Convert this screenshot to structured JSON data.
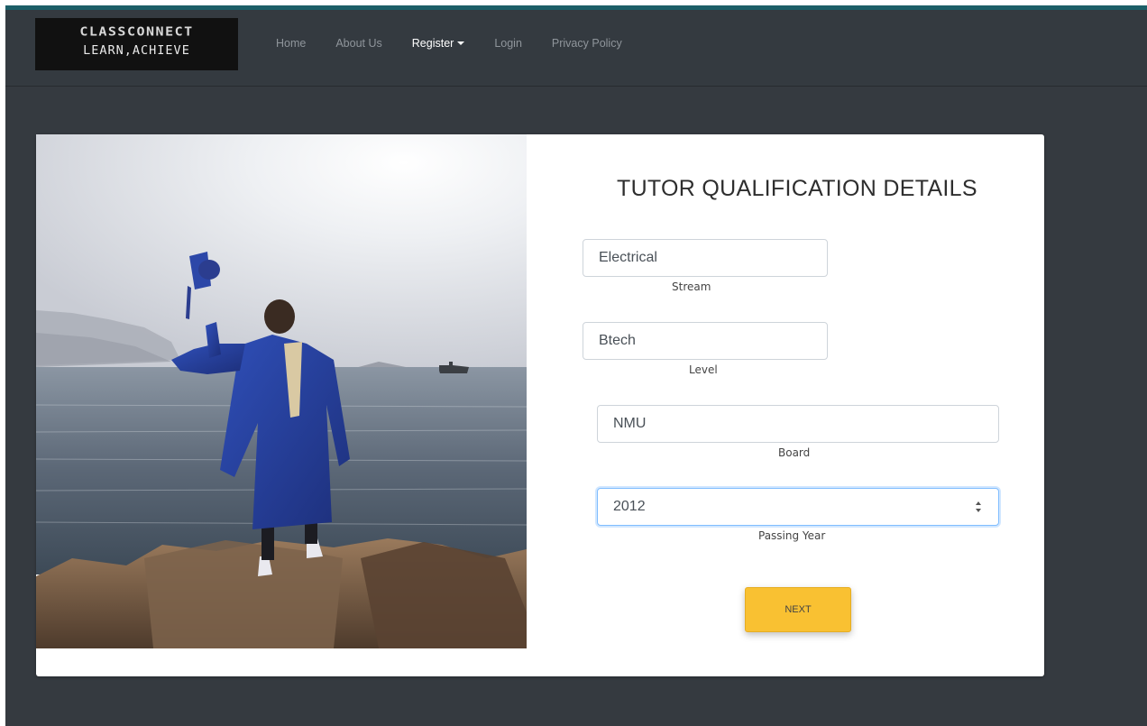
{
  "brand": {
    "line1": "CLASSCONNECT",
    "line2": "LEARN,ACHIEVE"
  },
  "nav": {
    "items": [
      {
        "label": "Home"
      },
      {
        "label": "About Us"
      },
      {
        "label": "Register"
      },
      {
        "label": "Login"
      },
      {
        "label": "Privacy Policy"
      }
    ],
    "active": "Register"
  },
  "form": {
    "title": "TUTOR QUALIFICATION DETAILS",
    "fields": [
      {
        "value": "Electrical",
        "label": "Stream"
      },
      {
        "value": "Btech",
        "label": "Level"
      },
      {
        "value": "NMU",
        "label": "Board"
      },
      {
        "value": "2012",
        "label": "Passing Year"
      }
    ],
    "next_label": "NEXT"
  },
  "colors": {
    "navbar_bg": "#343a40",
    "accent_top": "#1c5e67",
    "button_bg": "#f9c132",
    "focus_border": "#80bdff"
  },
  "icons": {
    "dropdown": "caret-down-icon",
    "spinner": "spin-arrows-icon"
  }
}
